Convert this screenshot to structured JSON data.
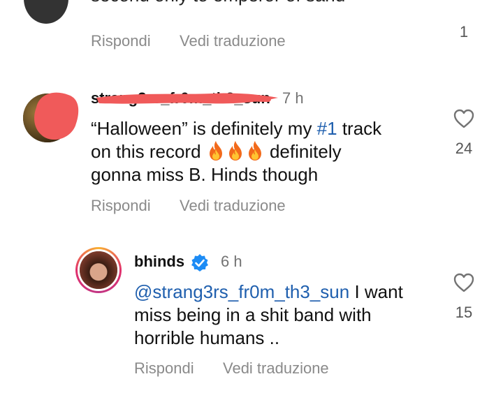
{
  "top_comment": {
    "cutoff_text": "second only to emperor of sand",
    "actions": {
      "reply": "Rispondi",
      "translate": "Vedi traduzione"
    },
    "like_count": "1"
  },
  "comment": {
    "username": "strang3rs_fr0m_th3_sun",
    "time": "7 h",
    "text_parts": {
      "part1": "“Halloween” is definitely my ",
      "hashtag": "#1",
      "part2": " track",
      "part3": "on this record ",
      "part4": " definitely",
      "part5": "gonna miss B. Hinds though"
    },
    "actions": {
      "reply": "Rispondi",
      "translate": "Vedi traduzione"
    },
    "like_count": "24"
  },
  "reply": {
    "username": "bhinds",
    "verified": true,
    "time": "6 h",
    "mention": "@strang3rs_fr0m_th3_sun",
    "text_parts": {
      "part1": " I want",
      "part2": "miss being in a shit band with",
      "part3": "horrible humans .."
    },
    "actions": {
      "reply": "Rispondi",
      "translate": "Vedi traduzione"
    },
    "like_count": "15"
  },
  "colors": {
    "mention_blue": "#1f5fae",
    "verified_blue": "#1d8cf5",
    "redaction_red": "#f05a5a",
    "story_ring": [
      "#f9b233",
      "#e1306c",
      "#c13584"
    ]
  }
}
